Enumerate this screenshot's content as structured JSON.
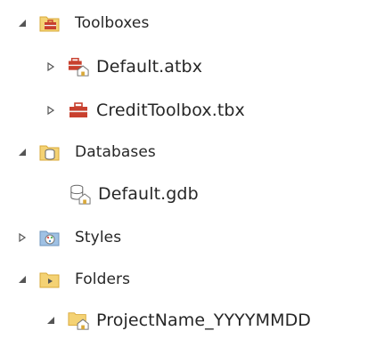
{
  "tree": {
    "toolboxes": {
      "label": "Toolboxes",
      "expander": "expanded-triangle-icon",
      "icon": "toolbox-folder-icon",
      "items": [
        {
          "label": "Default.atbx",
          "expander": "collapsed-triangle-icon",
          "icon": "default-toolbox-icon"
        },
        {
          "label": "CreditToolbox.tbx",
          "expander": "collapsed-triangle-icon",
          "icon": "toolbox-icon"
        }
      ]
    },
    "databases": {
      "label": "Databases",
      "expander": "expanded-triangle-icon",
      "icon": "database-folder-icon",
      "items": [
        {
          "label": "Default.gdb",
          "icon": "default-geodatabase-icon"
        }
      ]
    },
    "styles": {
      "label": "Styles",
      "expander": "collapsed-triangle-icon",
      "icon": "styles-folder-icon"
    },
    "folders": {
      "label": "Folders",
      "expander": "expanded-triangle-icon",
      "icon": "folders-icon",
      "items": [
        {
          "label": "ProjectName_YYYYMMDD",
          "expander": "expanded-triangle-icon",
          "icon": "home-folder-icon"
        }
      ]
    }
  },
  "colors": {
    "folder_fill": "#f4d274",
    "folder_dark": "#d9a93a",
    "toolbox_red": "#c8402e",
    "expander": "#555555",
    "text": "#262626"
  }
}
